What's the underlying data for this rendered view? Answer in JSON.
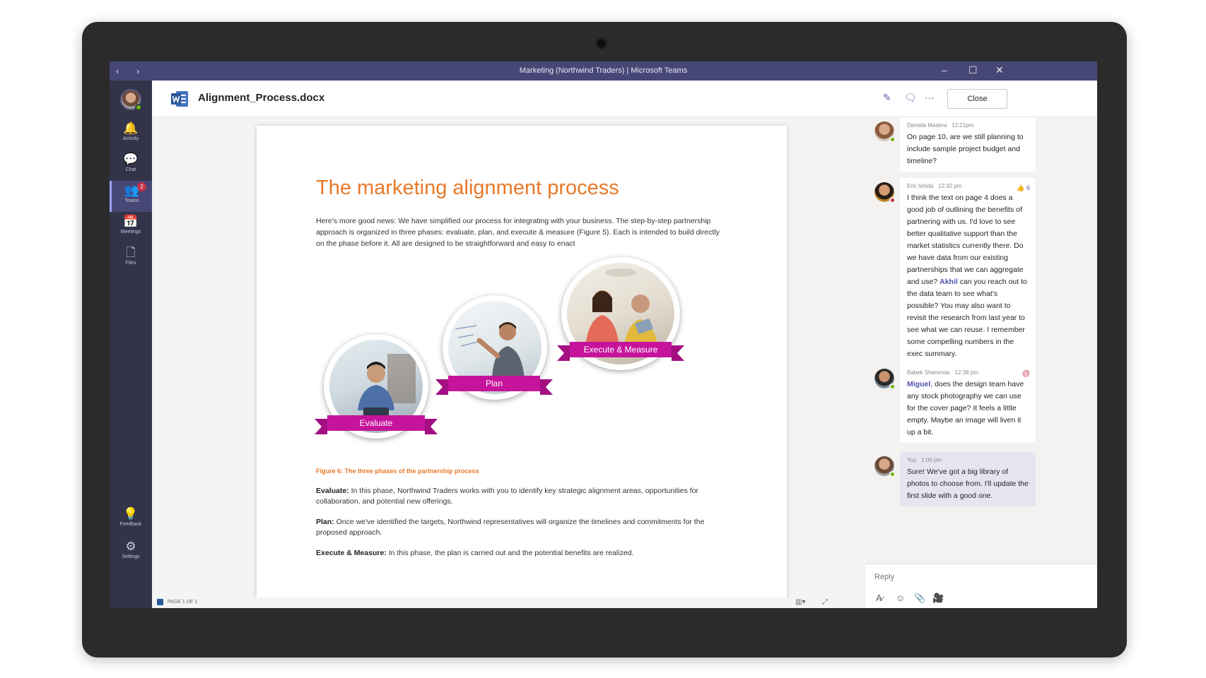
{
  "window": {
    "title": "Marketing (Northwind Traders)  |  Microsoft Teams",
    "nav_back": "‹",
    "nav_forward": "›",
    "minimize": "–",
    "maximize": "☐",
    "close": "✕"
  },
  "rail": {
    "items": [
      {
        "label": "Activity",
        "icon": "bell-icon",
        "glyph": "🔔"
      },
      {
        "label": "Chat",
        "icon": "chat-icon",
        "glyph": "💬"
      },
      {
        "label": "Teams",
        "icon": "teams-icon",
        "glyph": "👥",
        "badge": "2"
      },
      {
        "label": "Meetings",
        "icon": "calendar-icon",
        "glyph": "📅"
      },
      {
        "label": "Files",
        "icon": "file-icon",
        "glyph": "🗋"
      }
    ],
    "bottom": [
      {
        "label": "Feedback",
        "icon": "lightbulb-icon",
        "glyph": "💡"
      },
      {
        "label": "Settings",
        "icon": "gear-icon",
        "glyph": "⚙"
      }
    ]
  },
  "header": {
    "filename": "Alignment_Process.docx",
    "close_label": "Close",
    "more_label": "···"
  },
  "document": {
    "title": "The marketing alignment process",
    "intro": "Here's more good news: We have simplified our process for integrating with your business. The step-by-step partnership approach is organized in three phases: evaluate, plan, and execute & measure (Figure 5). Each is intended to build directly on the phase before it. All are designed to be straightforward and easy to enact",
    "phases": [
      "Evaluate",
      "Plan",
      "Execute & Measure"
    ],
    "figure_caption": "Figure 6: The three phases of the partnership process",
    "paragraphs": [
      {
        "term": "Evaluate:",
        "text": " In this phase, Northwind Traders works with you to identify key strategic alignment areas, opportunities for collaboration, and potential new offerings."
      },
      {
        "term": "Plan:",
        "text": " Once we've identified the targets, Northwind representatives will organize the timelines and commitments for the proposed approach."
      },
      {
        "term": "Execute & Measure:",
        "text": " In this phase, the plan is carried out and the potential benefits are realized."
      }
    ]
  },
  "statusbar": {
    "page_info": "PAGE 1 OF 1"
  },
  "chat": {
    "messages": [
      {
        "author": "Daniela Madera",
        "time": "12:21pm",
        "text": "On page 10, are we still planning to include sample project budget and timeline?"
      },
      {
        "author": "Eric Ishida",
        "time": "12:32 pm",
        "likes": "6",
        "text_before": "I think the text on page 4 does a good job of outlining the benefits of partnering with us. I'd love to see better qualitative support than the market statistics currently there. Do we have data from our existing partnerships that we can aggregate and use? ",
        "mention": "Akhil",
        "text_after": " can you reach out to the data team to see what's possible? You may also want to revisit the research from last year to see what we can reuse. I remember some compelling numbers in the exec summary."
      },
      {
        "author": "Babek Shammas",
        "time": "12:38 pm",
        "mention": "Miguel",
        "text_after": ", does the design team have any stock photography we can use for the cover page? It feels a little empty. Maybe an image will liven it up a bit."
      },
      {
        "author": "You",
        "time": "1:00 pm",
        "text": "Sure! We've got a big library of photos to choose from. I'll update the first slide with a good one."
      }
    ],
    "reply_placeholder": "Reply"
  },
  "colors": {
    "accent": "#6264a7",
    "title_bar": "#464775",
    "rail": "#33344a",
    "doc_title": "#e8792a",
    "ribbon": "#c5139c"
  }
}
